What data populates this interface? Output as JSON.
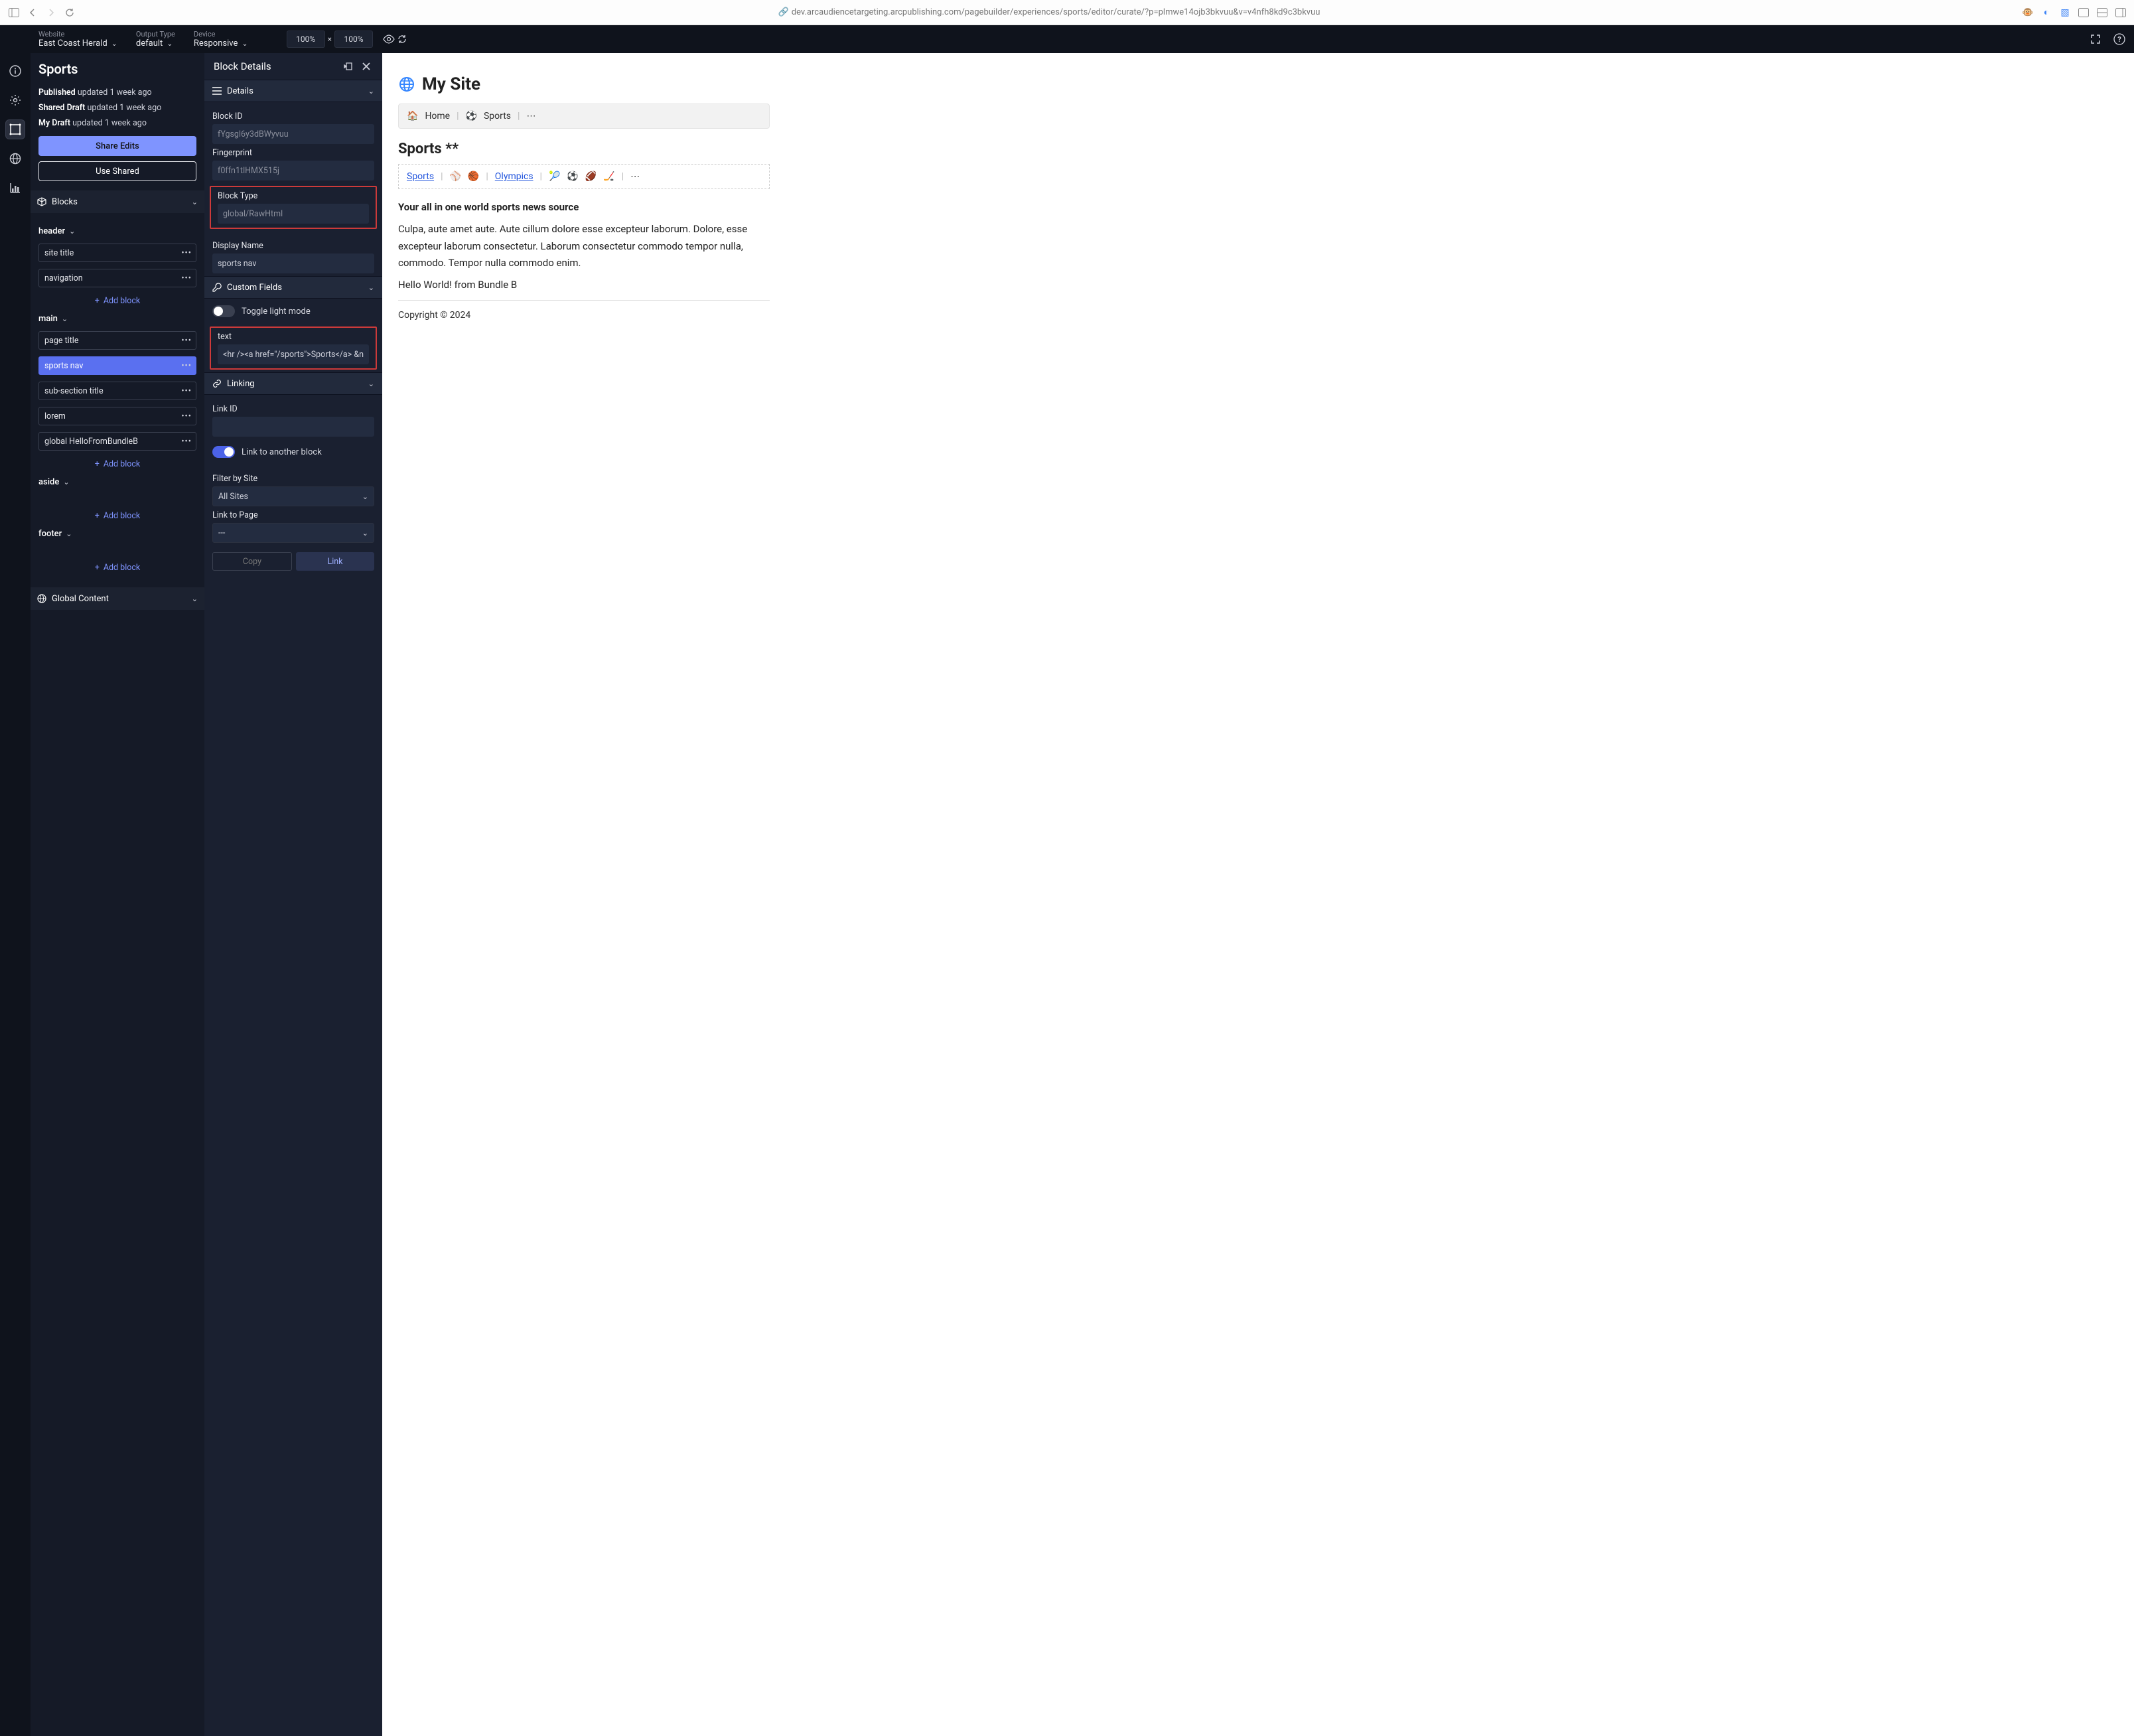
{
  "browser": {
    "url": "dev.arcaudiencetargeting.arcpublishing.com/pagebuilder/experiences/sports/editor/curate/?p=plmwe14ojb3bkvuu&v=v4nfh8kd9c3bkvuu"
  },
  "topbar": {
    "website_label": "Website",
    "website_value": "East Coast Herald",
    "output_label": "Output Type",
    "output_value": "default",
    "device_label": "Device",
    "device_value": "Responsive",
    "zoom_w": "100%",
    "zoom_h": "100%",
    "zoom_sep": "×"
  },
  "sidebar": {
    "title": "Sports",
    "published_label": "Published",
    "published_val": "updated 1 week ago",
    "shared_label": "Shared Draft",
    "shared_val": "updated 1 week ago",
    "mydraft_label": "My Draft",
    "mydraft_val": "updated 1 week ago",
    "share_btn": "Share Edits",
    "use_shared_btn": "Use Shared",
    "blocks_header": "Blocks",
    "global_content_header": "Global Content",
    "add_block": "Add block",
    "sections": {
      "header": "header",
      "main": "main",
      "aside": "aside",
      "footer": "footer"
    },
    "header_items": [
      "site title",
      "navigation"
    ],
    "main_items": [
      "page title",
      "sports nav",
      "sub-section title",
      "lorem",
      "global HelloFromBundleB"
    ]
  },
  "details": {
    "title": "Block Details",
    "details_section": "Details",
    "block_id_label": "Block ID",
    "block_id": "fYgsgl6y3dBWyvuu",
    "fingerprint_label": "Fingerprint",
    "fingerprint": "f0ffn1tlHMX515j",
    "block_type_label": "Block Type",
    "block_type": "global/RawHtml",
    "display_name_label": "Display Name",
    "display_name": "sports nav",
    "custom_fields_section": "Custom Fields",
    "toggle_light_label": "Toggle light mode",
    "text_label": "text",
    "text_value": "<hr /><a href=\"/sports\">Sports</a> &nbs",
    "linking_section": "Linking",
    "link_id_label": "Link ID",
    "link_id": "",
    "link_to_another_label": "Link to another block",
    "filter_label": "Filter by Site",
    "filter_value": "All Sites",
    "link_page_label": "Link to Page",
    "link_page_value": "---",
    "copy_btn": "Copy",
    "link_btn": "Link"
  },
  "preview": {
    "site_title": "My Site",
    "crumb_home": "Home",
    "crumb_sports": "Sports",
    "page_title": "Sports **",
    "nav_sports": "Sports",
    "nav_olympics": "Olympics",
    "tagline": "Your all in one world sports news source",
    "lorem": "Culpa, aute amet aute. Aute cillum dolore esse excepteur laborum. Dolore, esse excepteur laborum consectetur. Laborum consectetur commodo tempor nulla, commodo. Tempor nulla commodo enim.",
    "hello": "Hello World! from Bundle B",
    "copyright": "Copyright © 2024"
  }
}
